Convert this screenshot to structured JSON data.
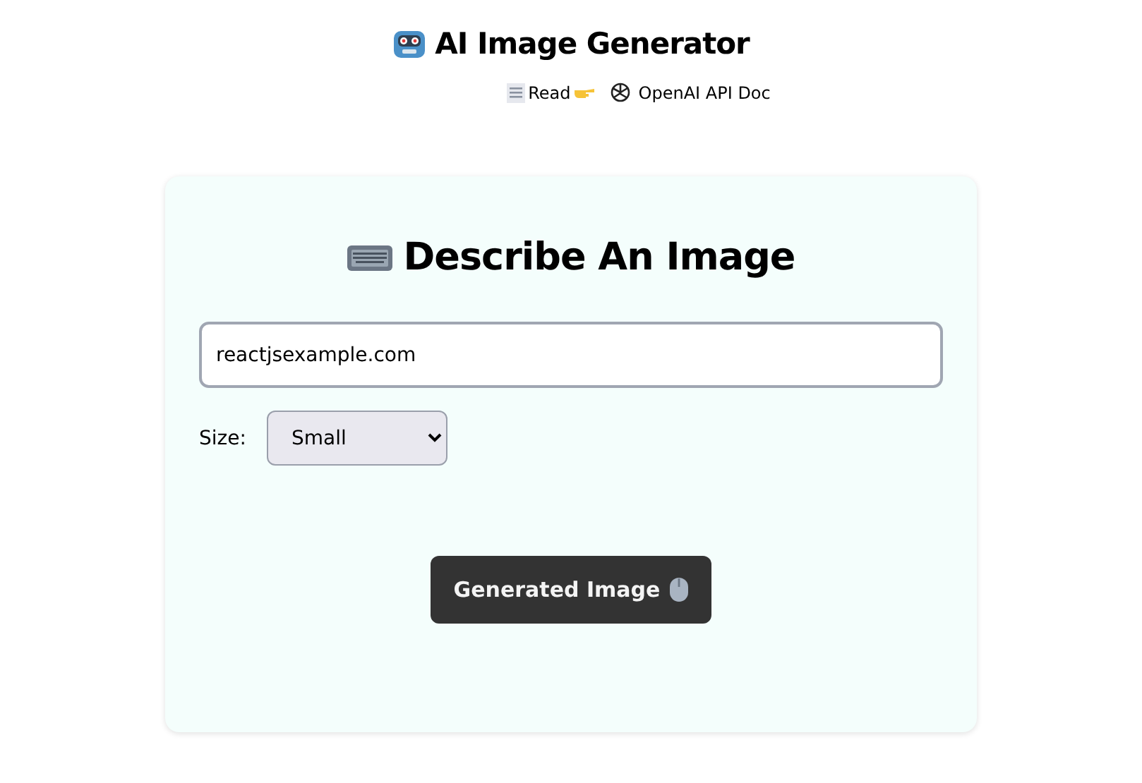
{
  "title": "AI Image Generator",
  "links": [
    {
      "label": "Read"
    },
    {
      "label": "OpenAI API Doc"
    }
  ],
  "card": {
    "heading": "Describe An Image",
    "prompt": {
      "value": "reactjsexample.com"
    },
    "size": {
      "label": "Size:",
      "value": "Small"
    },
    "button": "Generated Image"
  }
}
